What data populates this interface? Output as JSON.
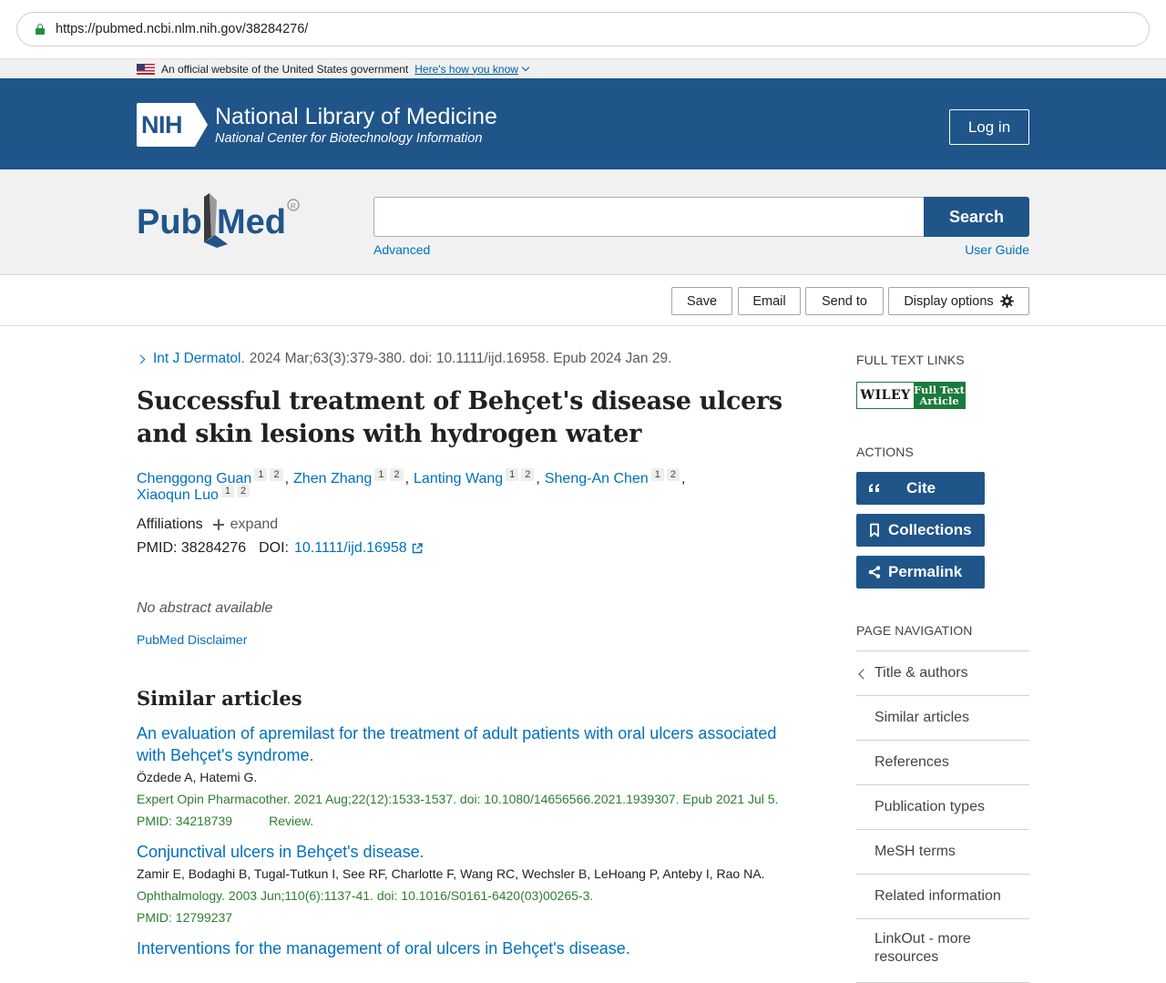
{
  "browser": {
    "url": "https://pubmed.ncbi.nlm.nih.gov/38284276/"
  },
  "gov_banner": {
    "text": "An official website of the United States government",
    "link": "Here's how you know"
  },
  "nih": {
    "badge": "NIH",
    "title": "National Library of Medicine",
    "subtitle": "National Center for Biotechnology Information",
    "login": "Log in"
  },
  "search": {
    "logo_text": "PubMed",
    "value": "",
    "button": "Search",
    "advanced": "Advanced",
    "user_guide": "User Guide"
  },
  "toolbar": {
    "save": "Save",
    "email": "Email",
    "send_to": "Send to",
    "display_options": "Display options"
  },
  "article": {
    "journal": "Int J Dermatol.",
    "citation": "2024 Mar;63(3):379-380. doi: 10.1111/ijd.16958. Epub 2024 Jan 29.",
    "title": "Successful treatment of Behçet's disease ulcers and skin lesions with hydrogen water",
    "authors": [
      {
        "name": "Chenggong Guan",
        "aff1": "1",
        "aff2": "2"
      },
      {
        "name": "Zhen Zhang",
        "aff1": "1",
        "aff2": "2"
      },
      {
        "name": "Lanting Wang",
        "aff1": "1",
        "aff2": "2"
      },
      {
        "name": "Sheng-An Chen",
        "aff1": "1",
        "aff2": "2"
      },
      {
        "name": "Xiaoqun Luo",
        "aff1": "1",
        "aff2": "2"
      }
    ],
    "affiliations_label": "Affiliations",
    "expand_label": "expand",
    "pmid_label": "PMID:",
    "pmid": "38284276",
    "doi_label": "DOI:",
    "doi": "10.1111/ijd.16958",
    "no_abstract": "No abstract available",
    "disclaimer": "PubMed Disclaimer"
  },
  "similar": {
    "heading": "Similar articles",
    "items": [
      {
        "title": "An evaluation of apremilast for the treatment of adult patients with oral ulcers associated with Behçet's syndrome.",
        "authors": "Özdede A, Hatemi G.",
        "citation": "Expert Opin Pharmacother. 2021 Aug;22(12):1533-1537. doi: 10.1080/14656566.2021.1939307. Epub 2021 Jul 5.",
        "pmid": "PMID: 34218739",
        "type": "Review."
      },
      {
        "title": "Conjunctival ulcers in Behçet's disease.",
        "authors": "Zamir E, Bodaghi B, Tugal-Tutkun I, See RF, Charlotte F, Wang RC, Wechsler B, LeHoang P, Anteby I, Rao NA.",
        "citation": "Ophthalmology. 2003 Jun;110(6):1137-41. doi: 10.1016/S0161-6420(03)00265-3.",
        "pmid": "PMID: 12799237",
        "type": ""
      },
      {
        "title": "Interventions for the management of oral ulcers in Behçet's disease.",
        "authors": "",
        "citation": "",
        "pmid": "",
        "type": ""
      }
    ]
  },
  "sidebar": {
    "full_text_heading": "FULL TEXT LINKS",
    "wiley_brand": "WILEY",
    "wiley_label": "Full Text Article",
    "actions_heading": "ACTIONS",
    "actions": {
      "cite": "Cite",
      "collections": "Collections",
      "permalink": "Permalink"
    },
    "page_nav_heading": "PAGE NAVIGATION",
    "page_nav": [
      "Title & authors",
      "Similar articles",
      "References",
      "Publication types",
      "MeSH terms",
      "Related information",
      "LinkOut - more resources"
    ]
  },
  "colors": {
    "nih_blue": "#20558a",
    "link": "#0071bc",
    "green": "#2f7d32"
  }
}
